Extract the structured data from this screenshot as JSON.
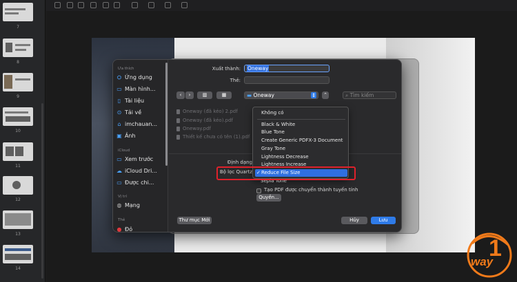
{
  "thumbnails": {
    "numbers": [
      "7",
      "8",
      "9",
      "10",
      "11",
      "12",
      "13",
      "14"
    ]
  },
  "dialog": {
    "export_label": "Xuất thành:",
    "export_value": "Oneway",
    "tags_label": "Thẻ:",
    "location": "Oneway",
    "search_placeholder": "Tìm kiếm",
    "sidebar": {
      "favorites_heading": "Ưa thích",
      "favorites": [
        {
          "label": "Ứng dụng",
          "icon": "apps-icon"
        },
        {
          "label": "Màn hình...",
          "icon": "desktop-icon"
        },
        {
          "label": "Tài liệu",
          "icon": "document-icon"
        },
        {
          "label": "Tải về",
          "icon": "download-icon"
        },
        {
          "label": "imchauan...",
          "icon": "home-icon"
        },
        {
          "label": "Ảnh",
          "icon": "photos-icon"
        }
      ],
      "icloud_heading": "iCloud",
      "icloud": [
        {
          "label": "Xem trước",
          "icon": "folder-icon"
        },
        {
          "label": "iCloud Dri...",
          "icon": "cloud-icon"
        },
        {
          "label": "Được chi...",
          "icon": "shared-folder-icon"
        }
      ],
      "locations_heading": "Vị trí",
      "locations": [
        {
          "label": "Mạng",
          "icon": "network-icon"
        }
      ],
      "tags_heading": "Thẻ",
      "tags": [
        {
          "label": "Đỏ",
          "icon": "red-tag-icon"
        }
      ]
    },
    "files": [
      "Oneway (đã kéo) 2.pdf",
      "Oneway (đã kéo).pdf",
      "Oneway.pdf",
      "Thiết kế chưa có tên (1).pdf"
    ],
    "format_label": "Định dạng",
    "quartz_label": "Bộ lọc Quartz",
    "checkbox_label": "Tạo PDF được chuyển thành tuyến tính",
    "permissions_button": "Quyền...",
    "new_folder_button": "Thư mục Mới",
    "cancel_button": "Hủy",
    "save_button": "Lưu"
  },
  "quartz_menu": {
    "items": [
      "Không có",
      "Black & White",
      "Blue Tone",
      "Create Generic PDFX-3 Document",
      "Gray Tone",
      "Lightness Decrease",
      "Lightness Increase",
      "Reduce File Size",
      "Sepia Tone"
    ],
    "selected": "Reduce File Size",
    "check": "✓"
  },
  "colors": {
    "accent": "#2f6fe0",
    "highlight_box": "#e0212b",
    "logo_orange": "#f07a1a"
  },
  "logo": {
    "text": "way",
    "numeral": "1"
  }
}
